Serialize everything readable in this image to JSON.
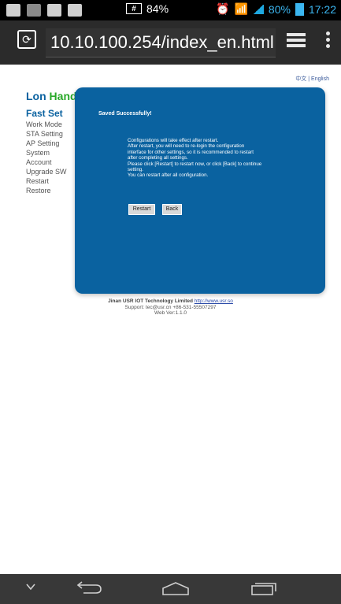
{
  "status_bar": {
    "signal_label": "84%",
    "battery_percent": "80%",
    "time": "17:22",
    "icons": [
      "image-icon",
      "photo-icon",
      "contacts-icon",
      "android-icon",
      "hash-icon",
      "alarm-icon",
      "wifi-icon",
      "signal-icon",
      "battery-icon"
    ]
  },
  "browser": {
    "url": "10.10.100.254/index_en.html"
  },
  "language": {
    "chinese": "中文",
    "separator": "|",
    "english": "English"
  },
  "brand": {
    "part1": "Lon",
    "part2": "Hand"
  },
  "nav": {
    "items": [
      "Fast Set",
      "Work Mode",
      "STA Setting",
      "AP Setting",
      "System",
      "Account",
      "Upgrade SW",
      "Restart",
      "Restore"
    ]
  },
  "panel": {
    "title": "Saved Successfully!",
    "message_lines": [
      "Configurations will take effect after restart.",
      "After restart, you will need to re-login the configuration",
      "interface for other settings, so it is recommended to restart",
      "after completing all settings.",
      "Please click [Restart] to restart now, or click [Back] to continue",
      "setting.",
      "You can restart after all configuration."
    ],
    "buttons": {
      "restart": "Restart",
      "back": "Back"
    }
  },
  "footer": {
    "company": "Jinan USR IOT Technology Limited",
    "link": "http://www.usr.so",
    "support": "Support: tec@usr.cn +86-531-55507297",
    "version": "Web Ver:1.1.0"
  }
}
